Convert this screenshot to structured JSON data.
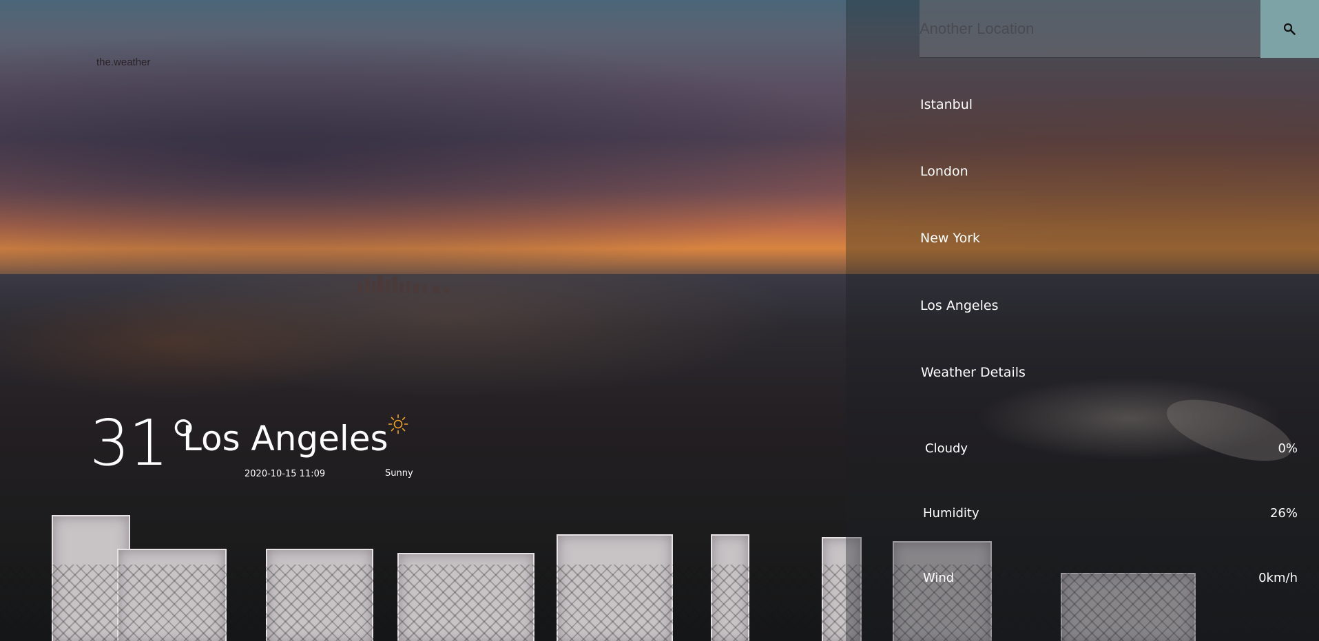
{
  "brand": "the.weather",
  "search": {
    "placeholder": "Another Location",
    "button_icon": "search-icon"
  },
  "locations": [
    {
      "label": "Istanbul"
    },
    {
      "label": "London"
    },
    {
      "label": "New York"
    },
    {
      "label": "Los Angeles"
    }
  ],
  "details": {
    "heading": "Weather Details",
    "rows": [
      {
        "label": "Cloudy",
        "value": "0%"
      },
      {
        "label": "Humidity",
        "value": "26%"
      },
      {
        "label": "Wind",
        "value": "0km/h"
      }
    ]
  },
  "current": {
    "temperature": "31°",
    "city": "Los Angeles",
    "datetime": "2020-10-15 11:09",
    "condition": "Sunny",
    "condition_icon": "sun-icon"
  },
  "colors": {
    "search_button": "#7ea3a6",
    "sun": "#f4a623",
    "text": "#ffffff"
  }
}
